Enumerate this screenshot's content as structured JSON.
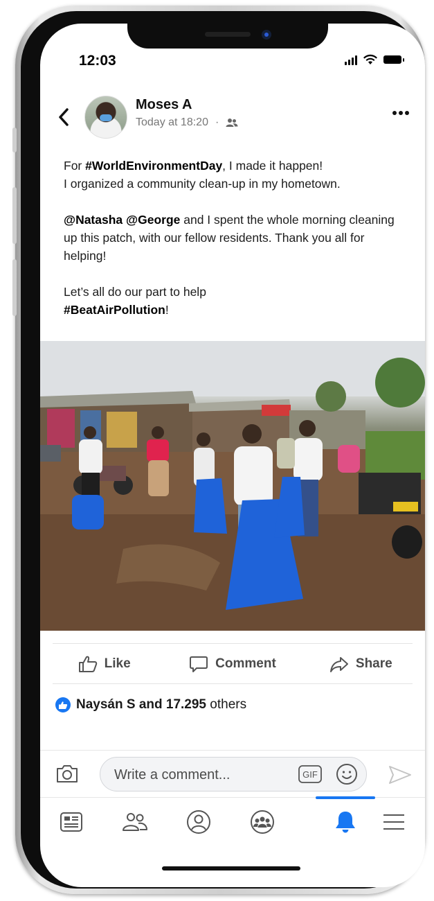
{
  "status_bar": {
    "time": "12:03",
    "icons": [
      "signal-icon",
      "wifi-icon",
      "battery-icon"
    ]
  },
  "post": {
    "author": "Moses A",
    "timestamp": "Today at 18:20",
    "separator": "·",
    "audience_icon": "friends-icon",
    "text": {
      "line1_prefix": "For ",
      "hashtag1": "#WorldEnvironmentDay",
      "line1_suffix": ", I made it happen!",
      "line2": "I organized a community clean-up in my hometown.",
      "mention1": "@Natasha",
      "mention2": "@George",
      "para2_rest": " and I spent the whole morning cleaning up this patch, with our fellow residents. Thank you all for helping!",
      "para3_prefix": "Let’s all do our part to help",
      "hashtag2": "#BeatAirPollution",
      "para3_suffix": "!"
    }
  },
  "actions": {
    "like": "Like",
    "comment": "Comment",
    "share": "Share"
  },
  "reactions": {
    "name": "Naysán S",
    "and": "and",
    "count": "17.295",
    "others": "others"
  },
  "comment_box": {
    "placeholder": "Write a comment...",
    "gif_label": "GIF"
  },
  "tab_bar": {
    "tabs": [
      "news-feed-icon",
      "friends-icon",
      "profile-icon",
      "groups-icon",
      "notifications-icon",
      "menu-icon"
    ],
    "active_tab": "notifications-icon"
  },
  "colors": {
    "accent": "#1877f2",
    "bag_blue": "#1f63d9"
  }
}
